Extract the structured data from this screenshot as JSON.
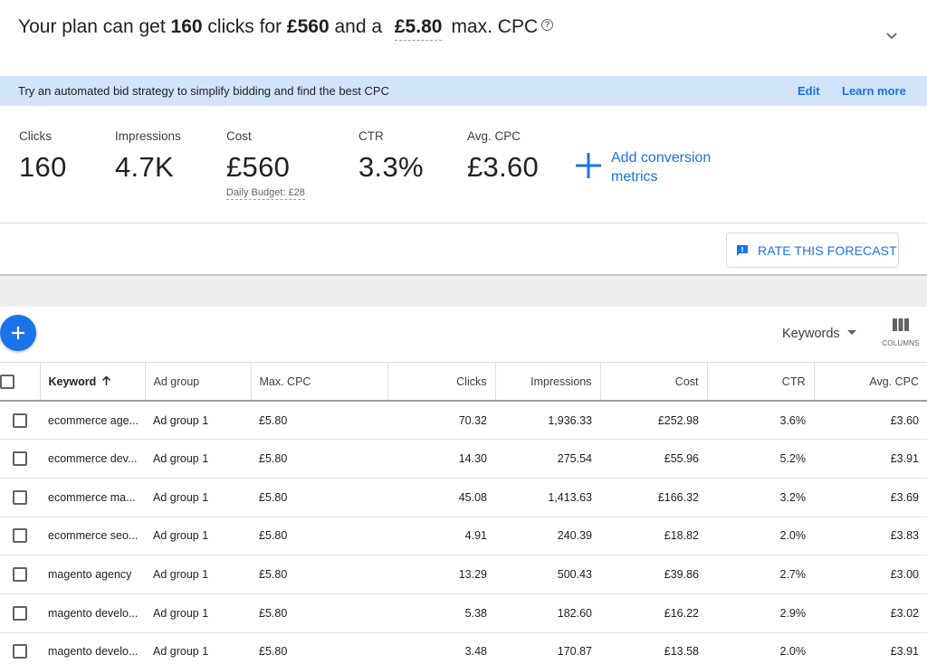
{
  "header": {
    "prefix": "Your plan can get ",
    "clicks": "160",
    "mid1": " clicks for ",
    "cost": "£560",
    "mid2": " and a ",
    "cpc": "£5.80",
    "suffix": "max. CPC"
  },
  "banner": {
    "message": "Try an automated bid strategy to simplify bidding and find the best CPC",
    "edit_label": "Edit",
    "learn_more_label": "Learn more"
  },
  "metrics": [
    {
      "label": "Clicks",
      "value": "160"
    },
    {
      "label": "Impressions",
      "value": "4.7K"
    },
    {
      "label": "Cost",
      "value": "£560",
      "sub": "Daily Budget: £28"
    },
    {
      "label": "CTR",
      "value": "3.3%"
    },
    {
      "label": "Avg. CPC",
      "value": "£3.60"
    }
  ],
  "add_conversion_label": "Add conversion metrics",
  "rate_forecast_label": "RATE THIS FORECAST",
  "toolbar": {
    "view_select": "Keywords",
    "columns_label": "COLUMNS"
  },
  "table": {
    "headers": [
      "Keyword",
      "Ad group",
      "Max. CPC",
      "Clicks",
      "Impressions",
      "Cost",
      "CTR",
      "Avg. CPC"
    ],
    "rows": [
      [
        "ecommerce age...",
        "Ad group 1",
        "£5.80",
        "70.32",
        "1,936.33",
        "£252.98",
        "3.6%",
        "£3.60"
      ],
      [
        "ecommerce dev...",
        "Ad group 1",
        "£5.80",
        "14.30",
        "275.54",
        "£55.96",
        "5.2%",
        "£3.91"
      ],
      [
        "ecommerce ma...",
        "Ad group 1",
        "£5.80",
        "45.08",
        "1,413.63",
        "£166.32",
        "3.2%",
        "£3.69"
      ],
      [
        "ecommerce seo...",
        "Ad group 1",
        "£5.80",
        "4.91",
        "240.39",
        "£18.82",
        "2.0%",
        "£3.83"
      ],
      [
        "magento agency",
        "Ad group 1",
        "£5.80",
        "13.29",
        "500.43",
        "£39.86",
        "2.7%",
        "£3.00"
      ],
      [
        "magento develo...",
        "Ad group 1",
        "£5.80",
        "5.38",
        "182.60",
        "£16.22",
        "2.9%",
        "£3.02"
      ],
      [
        "magento develo...",
        "Ad group 1",
        "£5.80",
        "3.48",
        "170.87",
        "£13.58",
        "2.0%",
        "£3.91"
      ]
    ]
  },
  "colors": {
    "accent": "#1a73e8",
    "banner_bg": "#d2e3fc",
    "text": "#202124"
  }
}
